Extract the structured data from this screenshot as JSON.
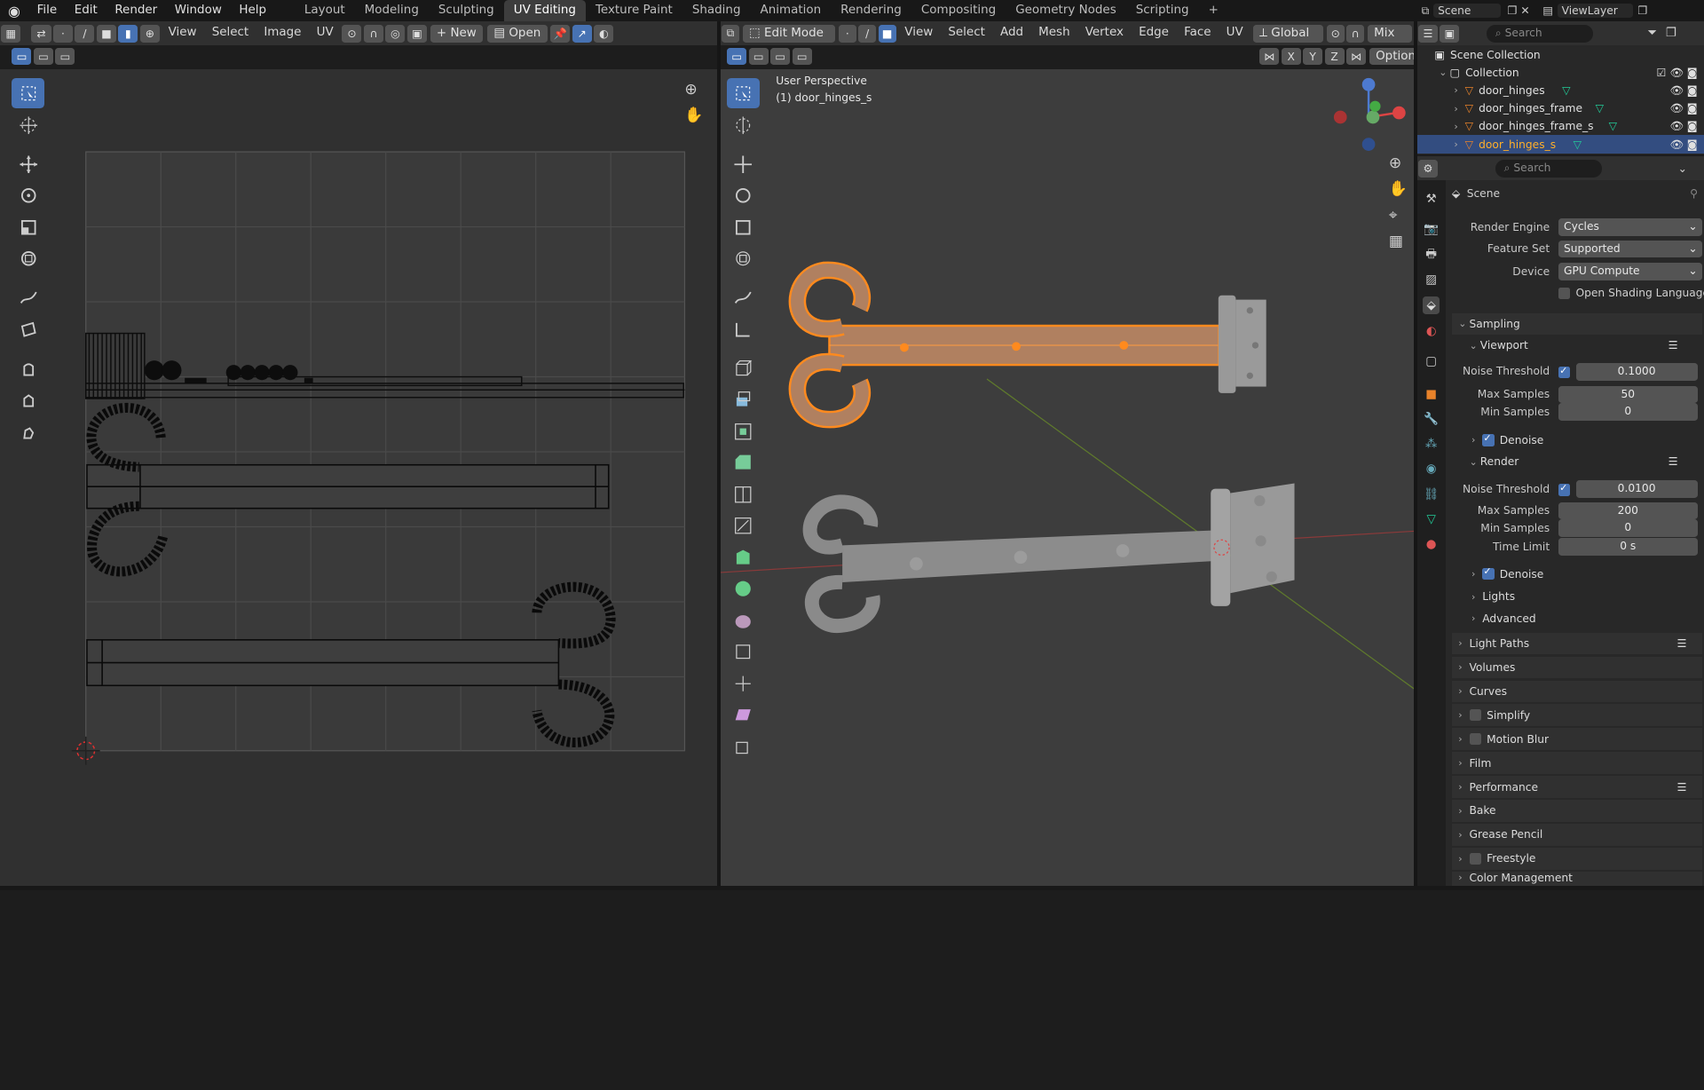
{
  "menu": {
    "file": "File",
    "edit": "Edit",
    "render": "Render",
    "window": "Window",
    "help": "Help"
  },
  "workspaces": [
    "Layout",
    "Modeling",
    "Sculpting",
    "UV Editing",
    "Texture Paint",
    "Shading",
    "Animation",
    "Rendering",
    "Compositing",
    "Geometry Nodes",
    "Scripting"
  ],
  "active_workspace": "UV Editing",
  "scene": {
    "name": "Scene",
    "view_layer": "ViewLayer",
    "search_placeholder": "Search"
  },
  "uv_editor": {
    "menus": [
      "View",
      "Select",
      "Image",
      "UV"
    ],
    "new_label": "New",
    "open_label": "Open"
  },
  "viewport": {
    "mode": "Edit Mode",
    "menus": [
      "View",
      "Select",
      "Add",
      "Mesh",
      "Vertex",
      "Edge",
      "Face",
      "UV"
    ],
    "orientation": "Global",
    "shading_mix": "Mix",
    "options": "Options",
    "axes": [
      "X",
      "Y",
      "Z"
    ],
    "overlay_line1": "User Perspective",
    "overlay_line2": "(1) door_hinges_s"
  },
  "outliner": {
    "search_placeholder": "Search",
    "root": "Scene Collection",
    "collection": "Collection",
    "items": [
      "door_hinges",
      "door_hinges_frame",
      "door_hinges_frame_s",
      "door_hinges_s"
    ],
    "selected_item": "door_hinges_s"
  },
  "properties": {
    "search_placeholder": "Search",
    "context": "Scene",
    "render_engine_label": "Render Engine",
    "render_engine": "Cycles",
    "feature_set_label": "Feature Set",
    "feature_set": "Supported",
    "device_label": "Device",
    "device": "GPU Compute",
    "osl": "Open Shading Language",
    "sampling": "Sampling",
    "viewport": {
      "title": "Viewport",
      "noise_threshold_label": "Noise Threshold",
      "noise_threshold": "0.1000",
      "max_samples_label": "Max Samples",
      "max_samples": "50",
      "min_samples_label": "Min Samples",
      "min_samples": "0",
      "denoise": "Denoise"
    },
    "render": {
      "title": "Render",
      "noise_threshold_label": "Noise Threshold",
      "noise_threshold": "0.0100",
      "max_samples_label": "Max Samples",
      "max_samples": "200",
      "min_samples_label": "Min Samples",
      "min_samples": "0",
      "time_limit_label": "Time Limit",
      "time_limit": "0 s",
      "denoise": "Denoise"
    },
    "lights": "Lights",
    "advanced": "Advanced",
    "sections": [
      "Light Paths",
      "Volumes",
      "Curves",
      "Simplify",
      "Motion Blur",
      "Film",
      "Performance",
      "Bake",
      "Grease Pencil",
      "Freestyle",
      "Color Management"
    ]
  },
  "colors": {
    "accent": "#4772b3",
    "selected_orange": "#e8822a",
    "header": "#303030",
    "background": "#1d1d1d"
  }
}
